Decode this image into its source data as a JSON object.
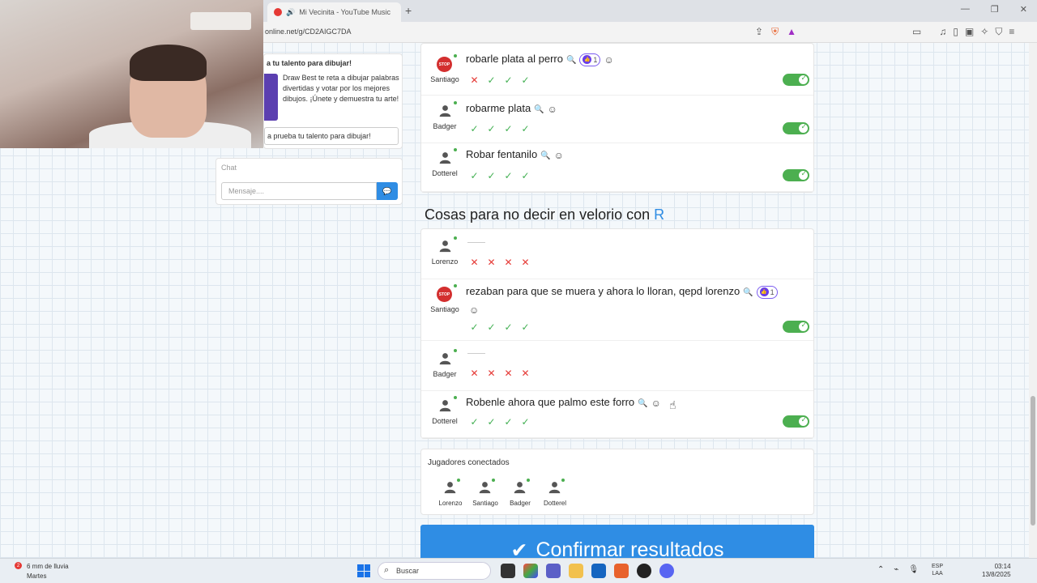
{
  "browser": {
    "tab_title": "Mi Vecinita - YouTube Music",
    "url": "online.net/g/CD2AIGC7DA"
  },
  "promo": {
    "title": "a tu talento para dibujar!",
    "description": "Draw Best te reta a dibujar palabras divertidas y votar por los mejores dibujos. ¡Únete y demuestra tu arte!",
    "button": "a prueba tu talento para dibujar!"
  },
  "chat": {
    "title": "Chat",
    "placeholder": "Mensaje...."
  },
  "previous_category": {
    "answers": [
      {
        "player": "Santiago",
        "avatar": "stop-sign",
        "text": "robarle plata al perro",
        "likes": "1",
        "votes": [
          "no",
          "ok",
          "ok",
          "ok"
        ],
        "accepted": true
      },
      {
        "player": "Badger",
        "avatar": "person",
        "text": "robarme plata",
        "likes": "",
        "votes": [
          "ok",
          "ok",
          "ok",
          "ok"
        ],
        "accepted": true
      },
      {
        "player": "Dotterel",
        "avatar": "person",
        "text": "Robar fentanilo",
        "likes": "",
        "votes": [
          "ok",
          "ok",
          "ok",
          "ok"
        ],
        "accepted": true
      }
    ]
  },
  "category": {
    "title": "Cosas para no decir en velorio con",
    "letter": "R",
    "answers": [
      {
        "player": "Lorenzo",
        "avatar": "person",
        "text": "",
        "likes": "",
        "votes": [
          "no",
          "no",
          "no",
          "no"
        ],
        "accepted": false
      },
      {
        "player": "Santiago",
        "avatar": "stop-sign",
        "text": "rezaban para que se muera y ahora lo lloran, qepd lorenzo",
        "likes": "1",
        "votes": [
          "ok",
          "ok",
          "ok",
          "ok"
        ],
        "accepted": true
      },
      {
        "player": "Badger",
        "avatar": "person",
        "text": "",
        "likes": "",
        "votes": [
          "no",
          "no",
          "no",
          "no"
        ],
        "accepted": false
      },
      {
        "player": "Dotterel",
        "avatar": "person",
        "text": "Robenle ahora que palmo este forro",
        "likes": "",
        "votes": [
          "ok",
          "ok",
          "ok",
          "ok"
        ],
        "accepted": true
      }
    ]
  },
  "players": {
    "title": "Jugadores conectados",
    "list": [
      "Lorenzo",
      "Santiago",
      "Badger",
      "Dotterel"
    ]
  },
  "confirm_label": "Confirmar resultados",
  "stop_label": "STOP",
  "taskbar": {
    "weather_line1": "6 mm de lluvia",
    "weather_line2": "Martes",
    "weather_badge": "2",
    "search": "Buscar",
    "lang1": "ESP",
    "lang2": "LAA",
    "time": "03:14",
    "date": "13/8/2025"
  },
  "colors": {
    "accent": "#2f8de4",
    "ok": "#43b053",
    "no": "#e53935",
    "toggle_on": "#4caf50",
    "like": "#6a3de8"
  }
}
